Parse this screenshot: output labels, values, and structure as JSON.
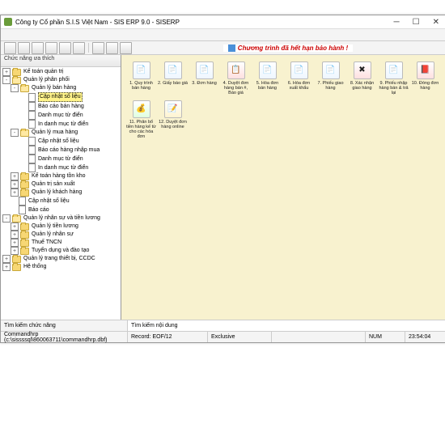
{
  "titlebar": {
    "text": "Công ty Cổ phần S.I.S Việt Nam - SIS ERP 9.0 - SISERP"
  },
  "sidebar": {
    "header": "Chức năng ưa thích",
    "tree": [
      {
        "d": 0,
        "e": "+",
        "t": "f",
        "l": "Kế toán quản trị"
      },
      {
        "d": 0,
        "e": "-",
        "t": "fo",
        "l": "Quản lý phân phối"
      },
      {
        "d": 1,
        "e": "-",
        "t": "fo",
        "l": "Quản lý bán hàng"
      },
      {
        "d": 2,
        "e": "",
        "t": "d",
        "l": "Cập nhật số liệu",
        "sel": true
      },
      {
        "d": 2,
        "e": "",
        "t": "d",
        "l": "Báo cáo bán hàng"
      },
      {
        "d": 2,
        "e": "",
        "t": "d",
        "l": "Danh mục từ điển"
      },
      {
        "d": 2,
        "e": "",
        "t": "d",
        "l": "In danh mục từ điển"
      },
      {
        "d": 1,
        "e": "-",
        "t": "fo",
        "l": "Quản lý mua hàng"
      },
      {
        "d": 2,
        "e": "",
        "t": "d",
        "l": "Cập nhật số liệu"
      },
      {
        "d": 2,
        "e": "",
        "t": "d",
        "l": "Báo cáo hàng nhập mua"
      },
      {
        "d": 2,
        "e": "",
        "t": "d",
        "l": "Danh mục từ điển"
      },
      {
        "d": 2,
        "e": "",
        "t": "d",
        "l": "In danh mục từ điển"
      },
      {
        "d": 1,
        "e": "+",
        "t": "f",
        "l": "Kế toán hàng tồn kho"
      },
      {
        "d": 1,
        "e": "+",
        "t": "f",
        "l": "Quản trị sản xuất"
      },
      {
        "d": 1,
        "e": "+",
        "t": "f",
        "l": "Quản lý khách hàng"
      },
      {
        "d": 1,
        "e": "",
        "t": "d",
        "l": "Cập nhật số liệu"
      },
      {
        "d": 1,
        "e": "",
        "t": "d",
        "l": "Báo cáo"
      },
      {
        "d": 0,
        "e": "-",
        "t": "fo",
        "l": "Quản lý nhân sự và tiền lương"
      },
      {
        "d": 1,
        "e": "+",
        "t": "f",
        "l": "Quản lý tiền lương"
      },
      {
        "d": 1,
        "e": "+",
        "t": "f",
        "l": "Quản lý nhân sự"
      },
      {
        "d": 1,
        "e": "+",
        "t": "f",
        "l": "Thuế TNCN"
      },
      {
        "d": 1,
        "e": "+",
        "t": "f",
        "l": "Tuyển dụng và đào tạo"
      },
      {
        "d": 0,
        "e": "+",
        "t": "f",
        "l": "Quản lý trang thiết bị, CCDC"
      },
      {
        "d": 0,
        "e": "+",
        "t": "f",
        "l": "Hệ thống"
      }
    ]
  },
  "banner": {
    "text": "Chương trình đã hết hạn bảo hành !"
  },
  "main": {
    "items": [
      {
        "l": "1. Quy trình bán hàng",
        "c": "sheet",
        "i": "📄"
      },
      {
        "l": "2. Giấy báo giá",
        "c": "sheet",
        "i": "📄"
      },
      {
        "l": "3. Đơn hàng",
        "c": "sheet",
        "i": "📄"
      },
      {
        "l": "4. Duyệt đơn hàng bán #, Báo giá",
        "c": "red",
        "i": "📋"
      },
      {
        "l": "5. Hóa đơn bán hàng",
        "c": "sheet",
        "i": "📄"
      },
      {
        "l": "6. Hóa đơn xuất khẩu",
        "c": "sheet",
        "i": "📄"
      },
      {
        "l": "7. Phiếu giao hàng",
        "c": "sheet",
        "i": "📄"
      },
      {
        "l": "8. Xác nhận giao hàng",
        "c": "red",
        "i": "✖"
      },
      {
        "l": "9. Phiếu nhập hàng bán & trả lại",
        "c": "sheet",
        "i": "📄"
      },
      {
        "l": "10. Đóng đơn hàng",
        "c": "red",
        "i": "📕"
      },
      {
        "l": "11. Phân bổ tiền hàng kế từ cho các hóa đơn",
        "c": "green",
        "i": "💰"
      },
      {
        "l": "12. Duyệt đơn hàng online",
        "c": "yellow",
        "i": "📝"
      }
    ]
  },
  "searchbar": {
    "left": "Tìm kiếm chức năng",
    "right": "Tìm kiếm nội dung"
  },
  "statusbar": {
    "path": "Commandhrp (c:\\sissssql\\860063711\\commandhrp.dbf)",
    "record": "Record: EOF/12",
    "mode": "Exclusive",
    "num": "NUM",
    "time": "23:54:04"
  }
}
